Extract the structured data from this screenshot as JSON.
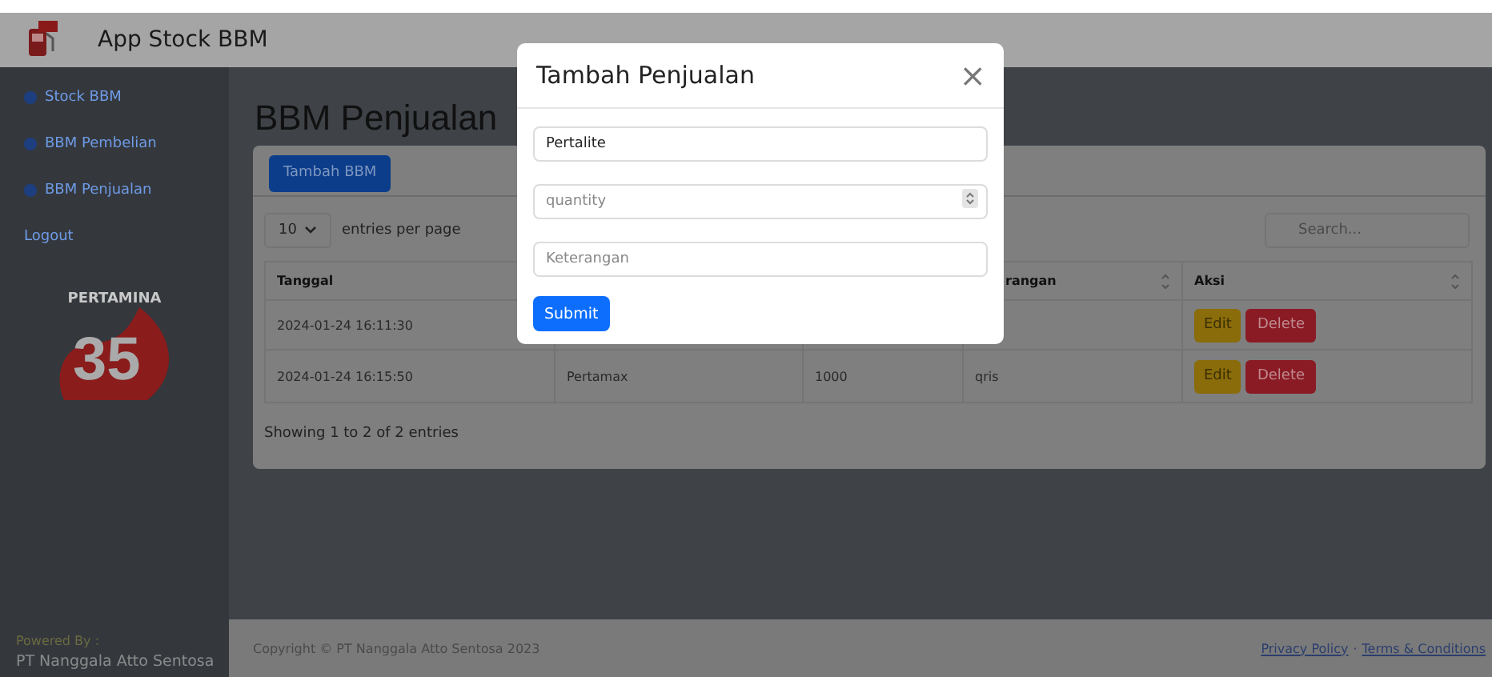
{
  "header": {
    "title": "App Stock BBM"
  },
  "sidebar": {
    "items": [
      {
        "label": "Stock BBM",
        "kind": "link"
      },
      {
        "label": "BBM Pembelian",
        "kind": "link"
      },
      {
        "label": "BBM Penjualan",
        "kind": "link"
      },
      {
        "label": "Logout",
        "kind": "plain"
      }
    ],
    "logo": {
      "brand": "PERTAMINA",
      "number": "35"
    },
    "powered_label": "Powered By :",
    "powered_by": "PT Nanggala Atto Sentosa"
  },
  "page_title": "BBM Penjualan",
  "card": {
    "add_button": "Tambah BBM",
    "page_size": "10",
    "page_size_caption": "entries per page",
    "search": {
      "placeholder": "Search..."
    },
    "table": {
      "columns": [
        {
          "label": "Tanggal"
        },
        {},
        {},
        {
          "label": "rangan",
          "sortable": true
        },
        {
          "label": "Aksi",
          "sortable": true
        }
      ],
      "rows": [
        {
          "cells": [
            "2024-01-24 16:11:30"
          ],
          "actions": [
            "Edit",
            "Delete"
          ]
        },
        {
          "cells": [
            "2024-01-24 16:15:50",
            "Pertamax",
            "1000",
            "qris"
          ],
          "actions": [
            "Edit",
            "Delete"
          ]
        }
      ]
    },
    "info": "Showing 1 to 2 of 2 entries"
  },
  "footer": {
    "copyright": "Copyright © PT Nanggala Atto Sentosa 2023",
    "links": [
      "Privacy Policy",
      "Terms & Conditions"
    ],
    "separator": "·"
  },
  "modal": {
    "title": "Tambah Penjualan",
    "close": "×",
    "fields": [
      {
        "kind": "text",
        "value": "Pertalite"
      },
      {
        "kind": "number",
        "placeholder": "quantity"
      },
      {
        "kind": "text",
        "placeholder": "Keterangan"
      }
    ],
    "submit": "Submit"
  }
}
